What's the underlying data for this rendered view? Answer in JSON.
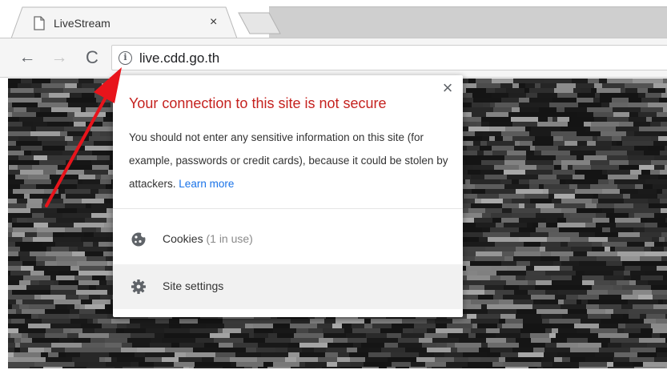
{
  "browser": {
    "tab": {
      "title": "LiveStream",
      "favicon": "page-icon",
      "close_glyph": "×"
    },
    "toolbar": {
      "back_glyph": "←",
      "forward_glyph": "→",
      "reload_glyph": "C",
      "info_glyph": "i",
      "url": "live.cdd.go.th"
    }
  },
  "popup": {
    "close_glyph": "×",
    "title": "Your connection to this site is not secure",
    "message": "You should not enter any sensitive information on this site (for example, passwords or credit cards), because it could be stolen by attackers.",
    "learn_more": "Learn more",
    "cookies": {
      "label": "Cookies",
      "note": "(1 in use)",
      "icon": "cookie-icon"
    },
    "site_settings": {
      "label": "Site settings",
      "icon": "gear-icon"
    }
  },
  "colors": {
    "warning_title": "#c5221f",
    "link": "#1a73e8",
    "annotation_arrow": "#e8141b",
    "page_background": "#1d1d1d"
  }
}
